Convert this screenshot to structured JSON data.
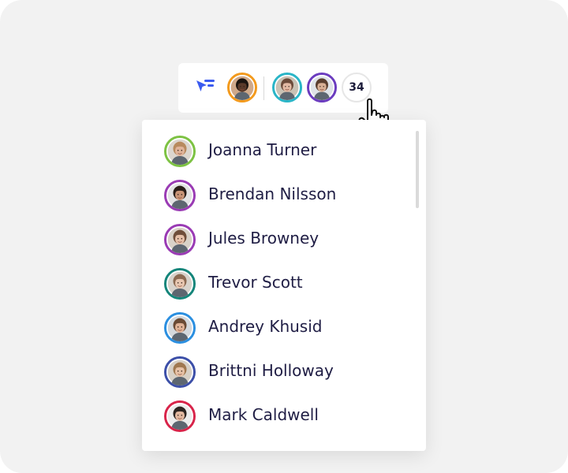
{
  "toolbar": {
    "follow_icon": "follow-cursor-icon",
    "avatars": [
      {
        "ring": "#f39a1d",
        "skin": "#5a3a2a",
        "hair": "#1b1410",
        "bg": "#cfa98a"
      },
      {
        "ring": "#2ab5c7",
        "skin": "#e2b9a4",
        "hair": "#6b4a3a",
        "bg": "#c9c2b5"
      },
      {
        "ring": "#6b3cbf",
        "skin": "#d9b095",
        "hair": "#5a3e2e",
        "bg": "#dfe3e8"
      }
    ],
    "count": "34"
  },
  "cursor": {
    "icon": "hand-pointer-icon"
  },
  "dropdown": {
    "users": [
      {
        "name": "Joanna Turner",
        "ring": "#7dc243",
        "skin": "#e0b49a",
        "hair": "#b88a5e",
        "bg": "#dcd6cf"
      },
      {
        "name": "Brendan Nilsson",
        "ring": "#9a3bb4",
        "skin": "#c99577",
        "hair": "#2a1e18",
        "bg": "#e3e3e3"
      },
      {
        "name": "Jules Browney",
        "ring": "#9a3bb4",
        "skin": "#e6c0a8",
        "hair": "#6f4e3a",
        "bg": "#d9d2c8"
      },
      {
        "name": "Trevor Scott",
        "ring": "#14857a",
        "skin": "#e8c6b0",
        "hair": "#8c6a52",
        "bg": "#d8d2cb"
      },
      {
        "name": "Andrey Khusid",
        "ring": "#2b8fe0",
        "skin": "#e0b296",
        "hair": "#6a4a34",
        "bg": "#d4d8dc"
      },
      {
        "name": "Brittni Holloway",
        "ring": "#3c4fa8",
        "skin": "#e6c1a6",
        "hair": "#a07850",
        "bg": "#d7d0c6"
      },
      {
        "name": "Mark Caldwell",
        "ring": "#d8244a",
        "skin": "#e2b8a0",
        "hair": "#2c2420",
        "bg": "#ececec"
      }
    ]
  }
}
